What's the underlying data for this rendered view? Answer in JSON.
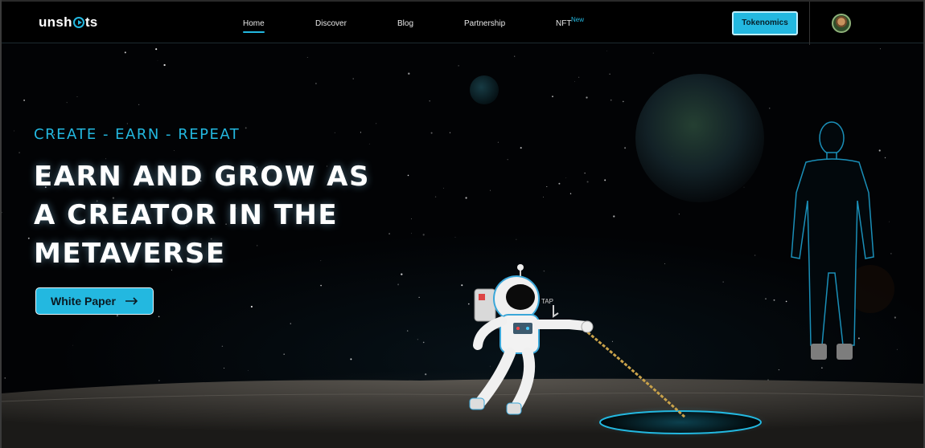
{
  "brand": {
    "name_prefix": "unsh",
    "name_suffix": "ts"
  },
  "nav": {
    "items": [
      {
        "label": "Home",
        "active": true
      },
      {
        "label": "Discover"
      },
      {
        "label": "Blog"
      },
      {
        "label": "Partnership"
      },
      {
        "label": "NFT",
        "badge": "New"
      }
    ],
    "cta_label": "Tokenomics",
    "avatar_icon": "user-avatar"
  },
  "hero": {
    "tagline": "CREATE - EARN - REPEAT",
    "headline_lines": [
      "EARN AND GROW AS",
      "A CREATOR IN THE",
      "METAVERSE"
    ],
    "button_label": "White Paper",
    "button_icon": "arrow-right-icon",
    "tap_label": "TAP"
  },
  "colors": {
    "accent": "#23b8e0",
    "background": "#020305"
  }
}
